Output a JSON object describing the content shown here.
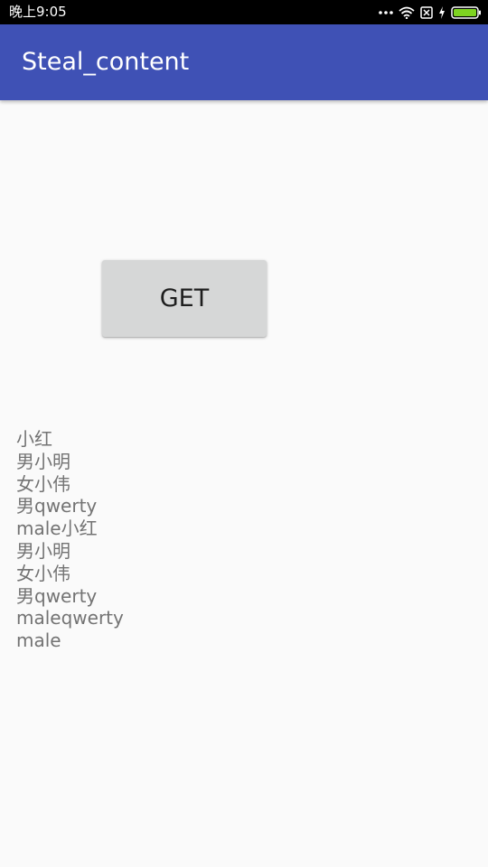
{
  "status_bar": {
    "time": "晚上9:05",
    "icons": [
      "more-dots-icon",
      "wifi-icon",
      "sim-off-icon",
      "charging-bolt-icon",
      "battery-icon"
    ],
    "battery_color": "#7ed321"
  },
  "app_bar": {
    "title": "Steal_content",
    "color": "#3f51b5"
  },
  "main": {
    "get_button_label": "GET",
    "result_lines": [
      "小红",
      "男小明",
      "女小伟",
      "男qwerty",
      "male小红",
      "男小明",
      "女小伟",
      "男qwerty",
      "maleqwerty",
      "male"
    ]
  }
}
